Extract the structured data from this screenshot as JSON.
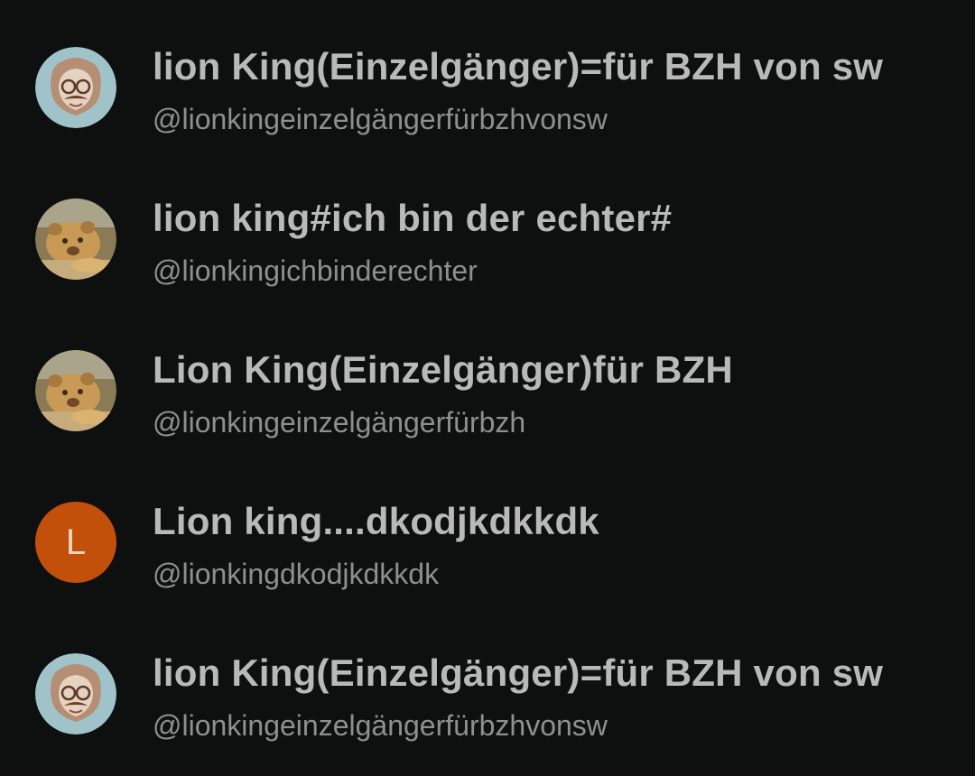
{
  "results": [
    {
      "name": "lion King(Einzelgänger)=für BZH von sw",
      "handle": "@lionkingeinzelgängerfürbzhvonsw",
      "avatar": "lion-sketch-icon"
    },
    {
      "name": "lion king#ich bin der echter#",
      "handle": "@lionkingichbinderechter",
      "avatar": "lion-cub-photo"
    },
    {
      "name": "Lion King(Einzelgänger)für BZH",
      "handle": "@lionkingeinzelgängerfürbzh",
      "avatar": "lion-cub-photo"
    },
    {
      "name": "Lion king....dkodjkdkkdk",
      "handle": "@lionkingdkodjkdkkdk",
      "avatar": "letter-avatar",
      "avatar_letter": "L",
      "avatar_color": "#c2500a"
    },
    {
      "name": "lion King(Einzelgänger)=für BZH von sw",
      "handle": "@lionkingeinzelgängerfürbzhvonsw",
      "avatar": "lion-sketch-icon"
    }
  ],
  "colors": {
    "background": "#0e0f0f",
    "name_text": "#b9b9b9",
    "handle_text": "#8f8f8f"
  }
}
